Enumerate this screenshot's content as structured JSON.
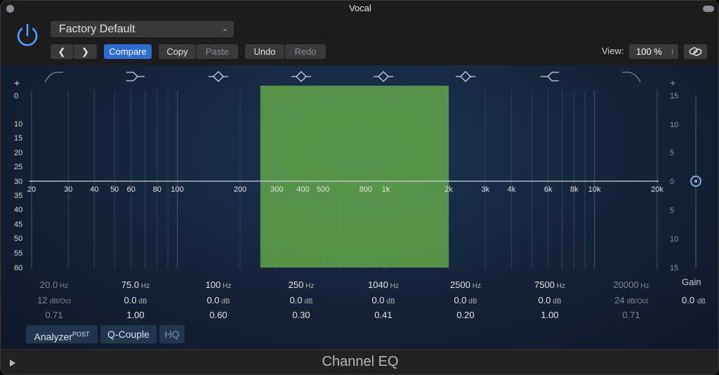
{
  "window": {
    "title": "Vocal"
  },
  "preset": {
    "name": "Factory Default"
  },
  "toolbar": {
    "compare": "Compare",
    "copy": "Copy",
    "paste": "Paste",
    "undo": "Undo",
    "redo": "Redo",
    "view_label": "View:",
    "view_value": "100 %"
  },
  "eq": {
    "left_scale": [
      "+",
      "0",
      "10",
      "15",
      "20",
      "25",
      "30",
      "35",
      "40",
      "45",
      "50",
      "55",
      "60"
    ],
    "right_scale": [
      "+",
      "15",
      "10",
      "5",
      "0",
      "5",
      "10",
      "15"
    ],
    "freq_labels": [
      "20",
      "30",
      "40",
      "50",
      "60",
      "80",
      "100",
      "200",
      "300",
      "400",
      "500",
      "800",
      "1k",
      "2k",
      "3k",
      "4k",
      "6k",
      "8k",
      "10k",
      "20k"
    ],
    "gain_db": 0.0,
    "selection": {
      "from_hz": 250,
      "to_hz": 2000,
      "color": "#5fa24a"
    },
    "bands": [
      {
        "freq": "20.0",
        "freq_unit": "Hz",
        "gain": "12",
        "gain_unit": "dB/Oct",
        "q": "0.71",
        "active": false,
        "icon": "low-cut-icon"
      },
      {
        "freq": "75.0",
        "freq_unit": "Hz",
        "gain": "0.0",
        "gain_unit": "dB",
        "q": "1.00",
        "active": true,
        "icon": "low-shelf-icon"
      },
      {
        "freq": "100",
        "freq_unit": "Hz",
        "gain": "0.0",
        "gain_unit": "dB",
        "q": "0.60",
        "active": true,
        "icon": "bell-icon"
      },
      {
        "freq": "250",
        "freq_unit": "Hz",
        "gain": "0.0",
        "gain_unit": "dB",
        "q": "0.30",
        "active": true,
        "icon": "bell-icon"
      },
      {
        "freq": "1040",
        "freq_unit": "Hz",
        "gain": "0.0",
        "gain_unit": "dB",
        "q": "0.41",
        "active": true,
        "icon": "bell-icon"
      },
      {
        "freq": "2500",
        "freq_unit": "Hz",
        "gain": "0.0",
        "gain_unit": "dB",
        "q": "0.20",
        "active": true,
        "icon": "bell-icon"
      },
      {
        "freq": "7500",
        "freq_unit": "Hz",
        "gain": "0.0",
        "gain_unit": "dB",
        "q": "1.00",
        "active": true,
        "icon": "high-shelf-icon"
      },
      {
        "freq": "20000",
        "freq_unit": "Hz",
        "gain": "24",
        "gain_unit": "dB/Oct",
        "q": "0.71",
        "active": false,
        "icon": "high-cut-icon"
      }
    ],
    "gain_label": "Gain",
    "gain_value": "0.0",
    "gain_unit": "dB"
  },
  "bottom": {
    "analyzer": "Analyzer",
    "analyzer_sup": "POST",
    "q_couple": "Q-Couple",
    "hq": "HQ"
  },
  "footer": {
    "plugin_name": "Channel EQ"
  },
  "colors": {
    "accent": "#2f6bd0",
    "power": "#4aa3ff",
    "selection": "#5fa24a"
  }
}
